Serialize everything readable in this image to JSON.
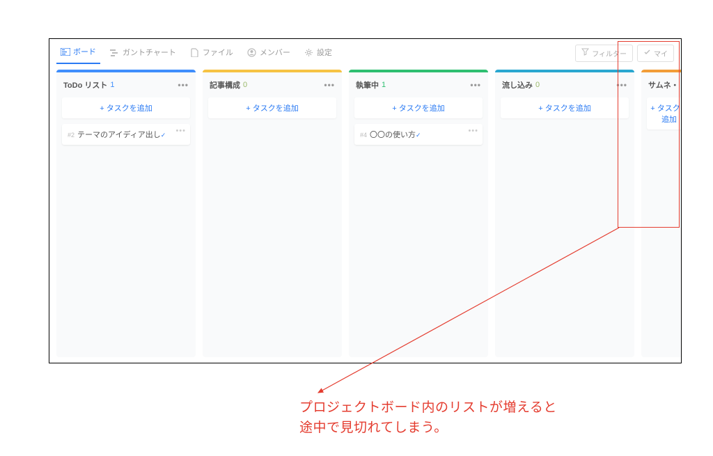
{
  "toolbar": {
    "tabs": [
      {
        "label": "ボード"
      },
      {
        "label": "ガントチャート"
      },
      {
        "label": "ファイル"
      },
      {
        "label": "メンバー"
      },
      {
        "label": "設定"
      }
    ],
    "filter_label": "フィルター",
    "mytask_label": "マイ"
  },
  "board": {
    "add_task_label": "+ タスクを追加",
    "columns": [
      {
        "title": "ToDo リスト",
        "count": 1,
        "color": "#3f8efc",
        "count_color": "#3f8efc",
        "cards": [
          {
            "id": "#2",
            "title": "テーマのアイディア出し"
          }
        ]
      },
      {
        "title": "記事構成",
        "count": 0,
        "color": "#f6c343",
        "count_color": "#9bb96b",
        "cards": []
      },
      {
        "title": "執筆中",
        "count": 1,
        "color": "#2fbf71",
        "count_color": "#2fbf71",
        "cards": [
          {
            "id": "#4",
            "title": "〇〇の使い方"
          }
        ]
      },
      {
        "title": "流し込み",
        "count": 0,
        "color": "#2aa7d0",
        "count_color": "#9bb96b",
        "cards": []
      },
      {
        "title": "サムネ・",
        "count": "",
        "color": "#f29d38",
        "count_color": "#999",
        "cards": []
      }
    ]
  },
  "annotation": {
    "line1": "プロジェクトボード内のリストが増えると",
    "line2": "途中で見切れてしまう。"
  }
}
